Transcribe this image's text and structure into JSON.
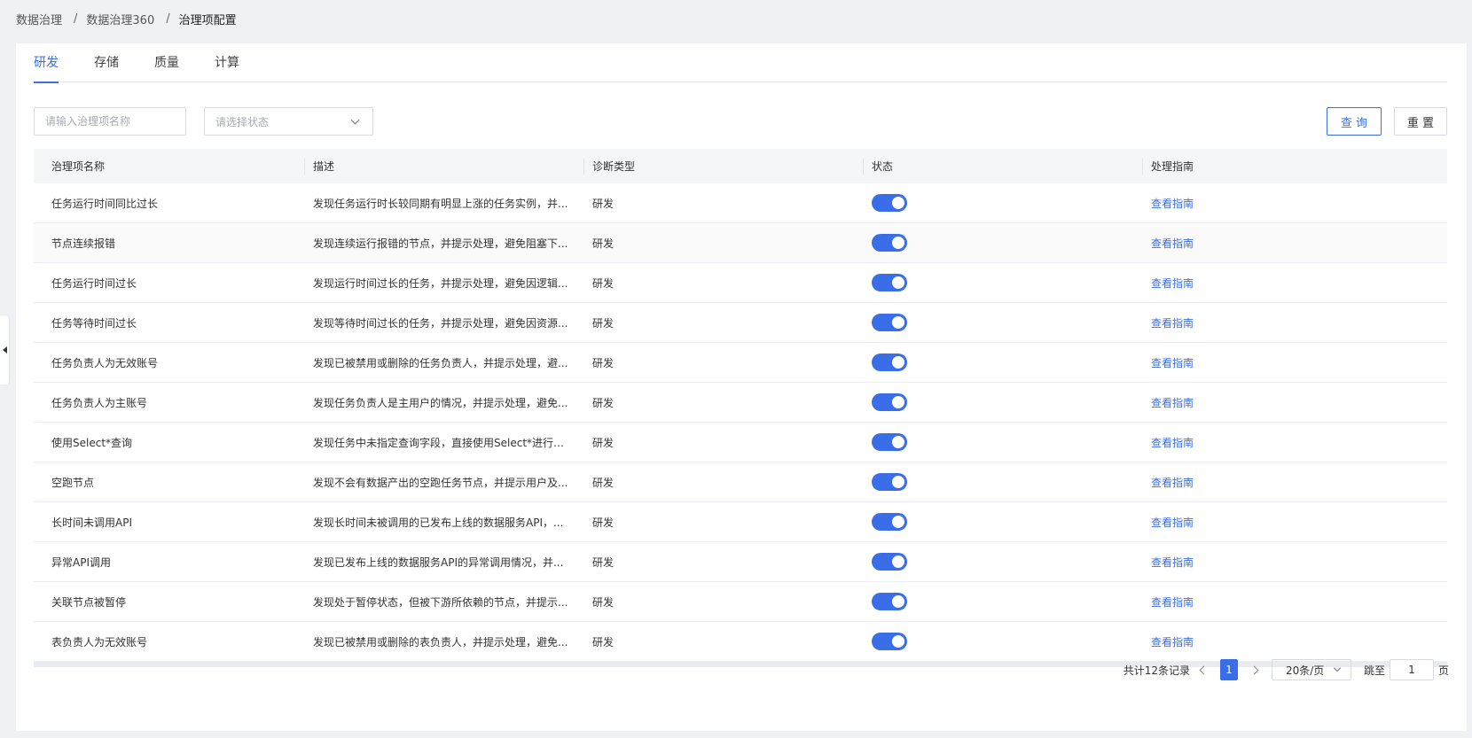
{
  "breadcrumb": [
    "数据治理",
    "数据治理360",
    "治理项配置"
  ],
  "tabs": [
    {
      "label": "研发",
      "active": true
    },
    {
      "label": "存储",
      "active": false
    },
    {
      "label": "质量",
      "active": false
    },
    {
      "label": "计算",
      "active": false
    }
  ],
  "filters": {
    "name_placeholder": "请输入治理项名称",
    "status_placeholder": "请选择状态",
    "query_label": "查 询",
    "reset_label": "重 置"
  },
  "table": {
    "columns": [
      "治理项名称",
      "描述",
      "诊断类型",
      "状态",
      "处理指南"
    ],
    "rows": [
      {
        "name": "任务运行时间同比过长",
        "desc": "发现任务运行时长较同期有明显上涨的任务实例，并...",
        "type": "研发",
        "enabled": true,
        "guide": "查看指南"
      },
      {
        "name": "节点连续报错",
        "desc": "发现连续运行报错的节点，并提示处理，避免阻塞下...",
        "type": "研发",
        "enabled": true,
        "guide": "查看指南"
      },
      {
        "name": "任务运行时间过长",
        "desc": "发现运行时间过长的任务，并提示处理，避免因逻辑...",
        "type": "研发",
        "enabled": true,
        "guide": "查看指南"
      },
      {
        "name": "任务等待时间过长",
        "desc": "发现等待时间过长的任务，并提示处理，避免因资源...",
        "type": "研发",
        "enabled": true,
        "guide": "查看指南"
      },
      {
        "name": "任务负责人为无效账号",
        "desc": "发现已被禁用或删除的任务负责人，并提示处理，避...",
        "type": "研发",
        "enabled": true,
        "guide": "查看指南"
      },
      {
        "name": "任务负责人为主账号",
        "desc": "发现任务负责人是主用户的情况，并提示处理，避免...",
        "type": "研发",
        "enabled": true,
        "guide": "查看指南"
      },
      {
        "name": "使用Select*查询",
        "desc": "发现任务中未指定查询字段，直接使用Select*进行查...",
        "type": "研发",
        "enabled": true,
        "guide": "查看指南"
      },
      {
        "name": "空跑节点",
        "desc": "发现不会有数据产出的空跑任务节点，并提示用户及...",
        "type": "研发",
        "enabled": true,
        "guide": "查看指南"
      },
      {
        "name": "长时间未调用API",
        "desc": "发现长时间未被调用的已发布上线的数据服务API，...",
        "type": "研发",
        "enabled": true,
        "guide": "查看指南"
      },
      {
        "name": "异常API调用",
        "desc": "发现已发布上线的数据服务API的异常调用情况，并...",
        "type": "研发",
        "enabled": true,
        "guide": "查看指南"
      },
      {
        "name": "关联节点被暂停",
        "desc": "发现处于暂停状态，但被下游所依赖的节点，并提示...",
        "type": "研发",
        "enabled": true,
        "guide": "查看指南"
      },
      {
        "name": "表负责人为无效账号",
        "desc": "发现已被禁用或删除的表负责人，并提示处理，避免...",
        "type": "研发",
        "enabled": true,
        "guide": "查看指南"
      }
    ]
  },
  "pagination": {
    "total_text": "共计12条记录",
    "current_page": "1",
    "page_size": "20条/页",
    "jump_label": "跳至",
    "jump_value": "1",
    "page_unit": "页"
  },
  "colors": {
    "accent": "#3a6ee8"
  }
}
